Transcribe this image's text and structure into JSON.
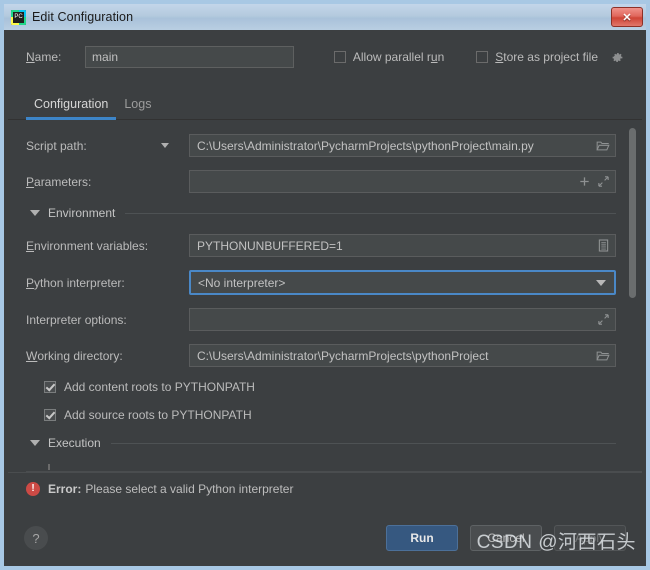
{
  "window": {
    "title": "Edit Configuration",
    "app_icon": "pycharm-icon",
    "close_label": "✕"
  },
  "name_row": {
    "label": "Name:",
    "label_mnemonic": "N",
    "value": "main",
    "allow_parallel": {
      "label_before": "Allow parallel r",
      "mnemonic": "u",
      "label_after": "n",
      "checked": false
    },
    "store_project_file": {
      "mnemonic": "S",
      "label_after": "tore as project file",
      "checked": false
    },
    "gear_icon": "gear-icon"
  },
  "tabs": [
    {
      "label": "Configuration",
      "active": true
    },
    {
      "label": "Logs",
      "active": false
    }
  ],
  "form": {
    "script_path": {
      "label": "Script path:",
      "value": "C:\\Users\\Administrator\\PycharmProjects\\pythonProject\\main.py",
      "browse_icon": "folder-icon",
      "has_dropdown": true
    },
    "parameters": {
      "label_mnemonic": "P",
      "label_after": "arameters:",
      "value": "",
      "add_icon": "plus-icon",
      "expand_icon": "expand-icon"
    },
    "environment_section": {
      "title": "Environment",
      "expanded": true
    },
    "environment_variables": {
      "label_mnemonic": "E",
      "label_after": "nvironment variables:",
      "value": "PYTHONUNBUFFERED=1",
      "browse_icon": "list-icon"
    },
    "python_interpreter": {
      "label_mnemonic": "P",
      "label_after": "ython interpreter:",
      "value": "<No interpreter>",
      "focused": true,
      "caret_icon": "chevron-down-icon"
    },
    "interpreter_options": {
      "label": "Interpreter options:",
      "value": "",
      "expand_icon": "expand-icon"
    },
    "working_directory": {
      "label_mnemonic": "W",
      "label_after": "orking directory:",
      "value": "C:\\Users\\Administrator\\PycharmProjects\\pythonProject",
      "browse_icon": "folder-icon"
    },
    "add_content_roots": {
      "label": "Add content roots to PYTHONPATH",
      "checked": true
    },
    "add_source_roots": {
      "label": "Add source roots to PYTHONPATH",
      "checked": true
    },
    "execution_section": {
      "title": "Execution",
      "expanded": true
    }
  },
  "error": {
    "icon": "error-icon",
    "badge": "!",
    "strong": "Error:",
    "message": "Please select a valid Python interpreter"
  },
  "footer": {
    "help_label": "?",
    "run_label": "Run",
    "cancel_label": "Cancel",
    "apply_label": "Apply"
  },
  "watermark": {
    "text": "CSDN @河西石头"
  },
  "colors": {
    "accent_blue": "#3d85c8",
    "focus_blue": "#4a88c7",
    "default_button": "#365880",
    "error_red": "#cc4a45",
    "panel_bg": "#3c3f41",
    "field_bg": "#45494a",
    "titlebar": "#b4cade"
  }
}
